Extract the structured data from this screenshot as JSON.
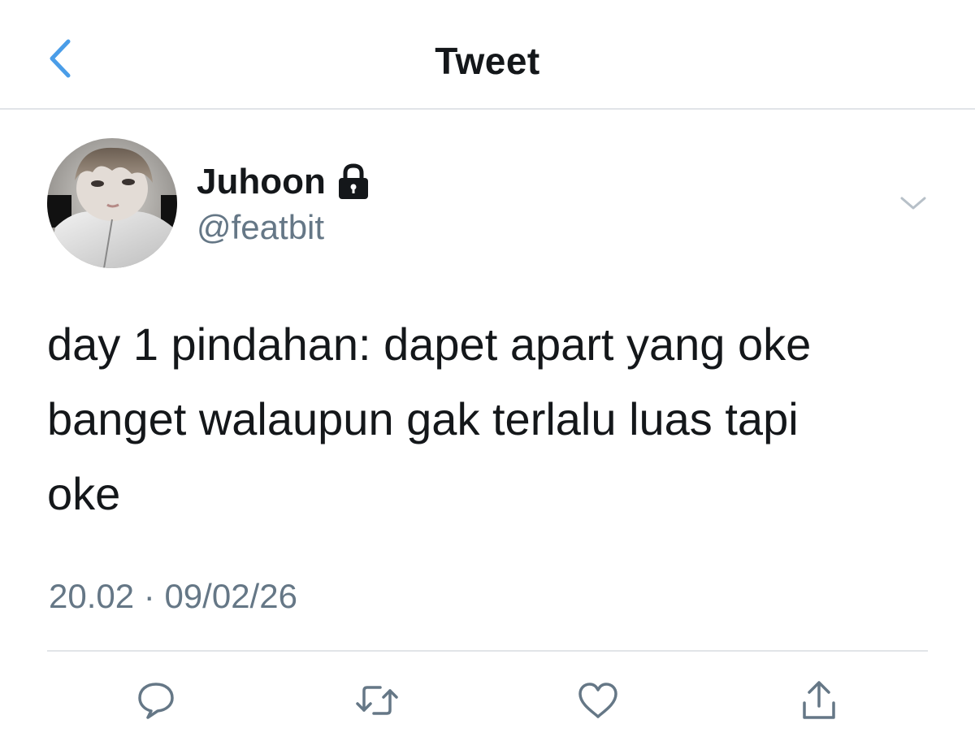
{
  "header": {
    "title": "Tweet",
    "back_icon": "chevron-left-icon"
  },
  "author": {
    "name": "Juhoon",
    "handle": "@featbit",
    "protected_icon": "lock-icon",
    "avatar": "profile-photo",
    "menu_icon": "chevron-down-icon"
  },
  "tweet": {
    "text": "day 1 pindahan: dapet apart yang oke\nbanget walaupun gak terlalu luas tapi\noke",
    "time": "20.02",
    "separator": "·",
    "date": "09/02/26"
  },
  "actions": [
    {
      "icon": "reply-icon"
    },
    {
      "icon": "retweet-icon"
    },
    {
      "icon": "like-icon"
    },
    {
      "icon": "share-icon"
    }
  ],
  "colors": {
    "accent": "#4a9de8",
    "text": "#14171a",
    "secondary": "#657786",
    "divider": "#e1e4e8",
    "icon_gray": "#657786"
  }
}
